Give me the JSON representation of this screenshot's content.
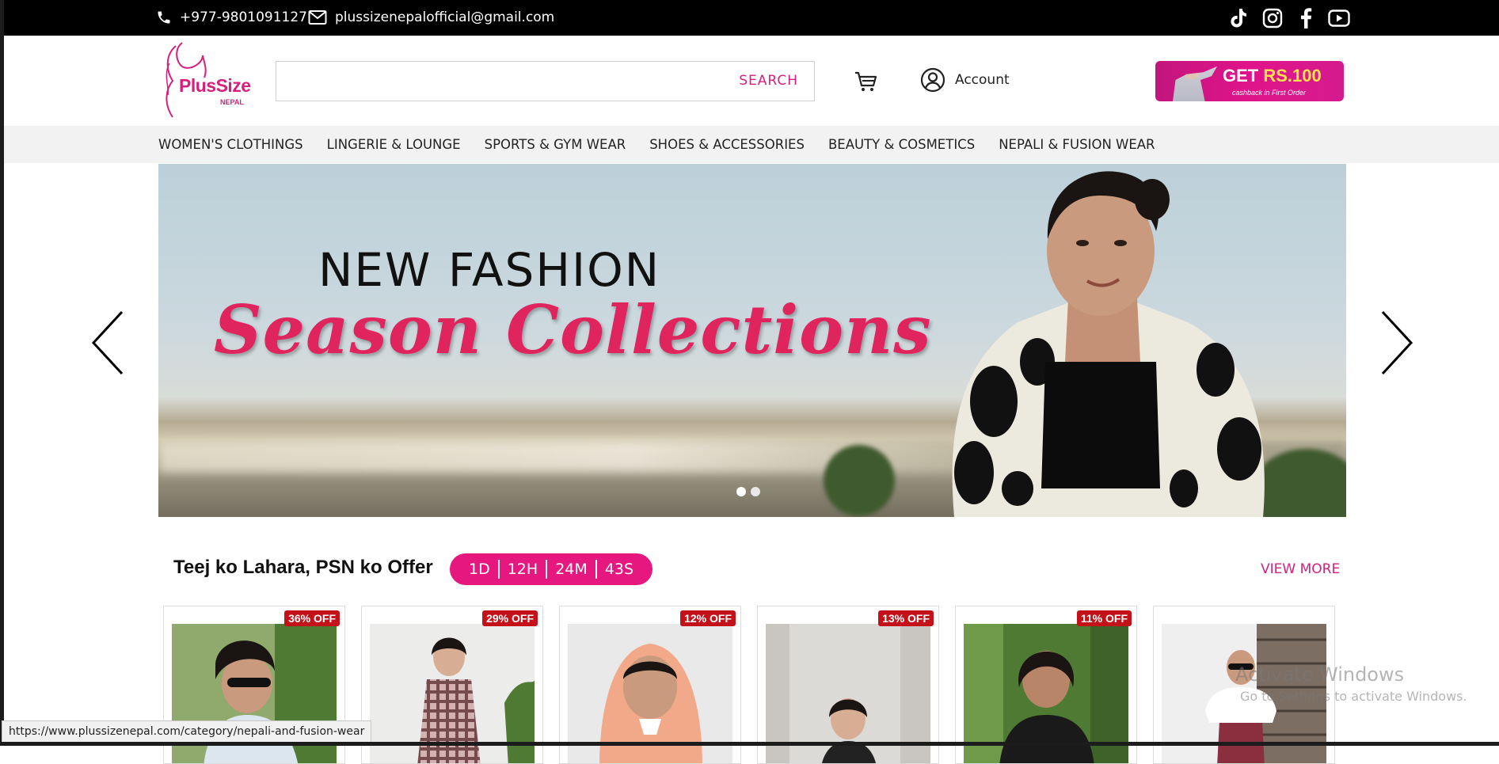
{
  "topbar": {
    "phone": "+977-9801091127",
    "email": "plussizenepalofficial@gmail.com",
    "social": [
      "tiktok-icon",
      "instagram-icon",
      "facebook-icon",
      "youtube-icon"
    ]
  },
  "header": {
    "logo_main": "PlusSize",
    "logo_sub": "NEPAL",
    "search_placeholder": "",
    "search_label": "SEARCH",
    "account_label": "Account",
    "promo_get": "GET",
    "promo_amount": "RS.100",
    "promo_sub": "cashback in First Order"
  },
  "nav": {
    "items": [
      "WOMEN'S CLOTHINGS",
      "LINGERIE & LOUNGE",
      "SPORTS & GYM WEAR",
      "SHOES & ACCESSORIES",
      "BEAUTY & COSMETICS",
      "NEPALI & FUSION WEAR"
    ]
  },
  "banner": {
    "headline_1": "NEW FASHION",
    "headline_2": "Season Collections",
    "slides": 2,
    "active_slide": 1
  },
  "offer": {
    "title": "Teej ko Lahara, PSN ko Offer",
    "countdown": [
      "1D",
      "12H",
      "24M",
      "43S"
    ],
    "view_more": "VIEW MORE"
  },
  "products": [
    {
      "discount": "36% OFF"
    },
    {
      "discount": "29% OFF"
    },
    {
      "discount": "12% OFF"
    },
    {
      "discount": "13% OFF"
    },
    {
      "discount": "11% OFF"
    },
    {
      "discount": ""
    }
  ],
  "watermark": {
    "line1": "Activate Windows",
    "line2": "Go to Settings to activate Windows."
  },
  "status_url": "https://www.plussizenepal.com/category/nepali-and-fusion-wear",
  "colors": {
    "brand_pink": "#d6207e",
    "countdown_bg": "#e6177f",
    "badge_red": "#c4121a",
    "topbar_bg": "#000000",
    "nav_bg": "#f2f2f2"
  }
}
